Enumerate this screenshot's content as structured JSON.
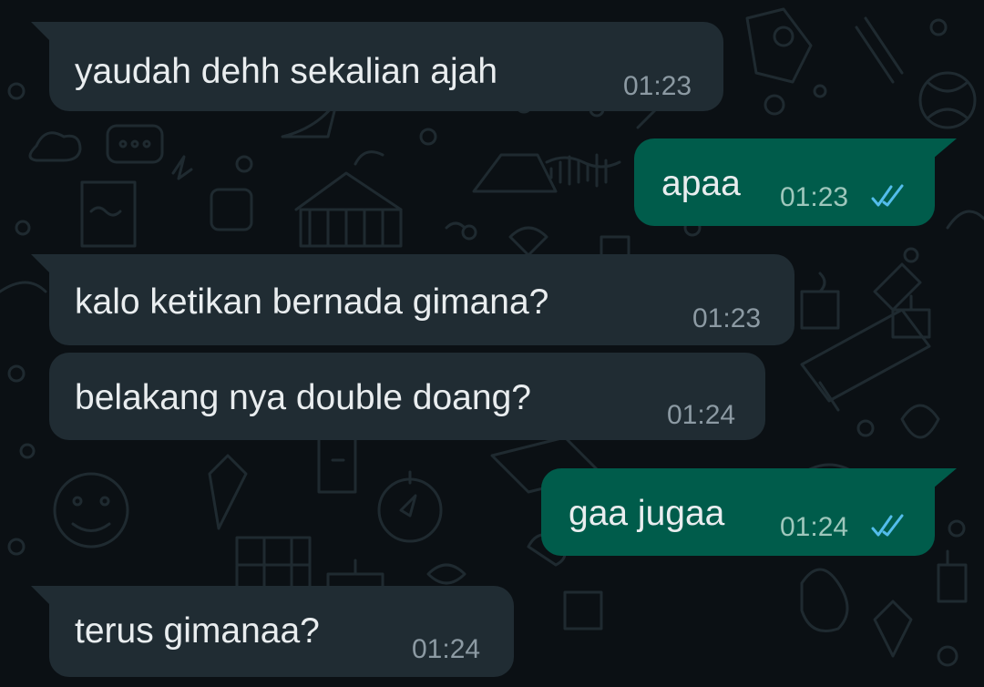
{
  "chat": {
    "messages": [
      {
        "direction": "incoming",
        "text": "yaudah dehh sekalian ajah",
        "time": "01:23"
      },
      {
        "direction": "outgoing",
        "text": "apaa",
        "time": "01:23",
        "status": "read",
        "status_icon": "double-check-icon",
        "status_color": "#53bdeb"
      },
      {
        "direction": "incoming",
        "text": "kalo ketikan bernada gimana?",
        "time": "01:23"
      },
      {
        "direction": "incoming",
        "text": "belakang nya double doang?",
        "time": "01:24"
      },
      {
        "direction": "outgoing",
        "text": "gaa jugaa",
        "time": "01:24",
        "status": "read",
        "status_icon": "double-check-icon",
        "status_color": "#53bdeb"
      },
      {
        "direction": "incoming",
        "text": "terus gimanaa?",
        "time": "01:24"
      }
    ]
  },
  "colors": {
    "background": "#0b1014",
    "incoming_bubble": "#202c33",
    "outgoing_bubble": "#005c4b",
    "text": "#e9edef",
    "timestamp": "#8c9aa3",
    "read_ticks": "#53bdeb"
  }
}
